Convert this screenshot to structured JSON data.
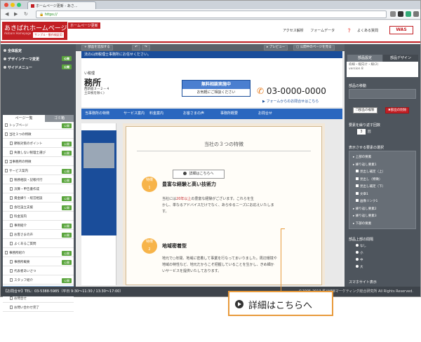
{
  "browser": {
    "tab_title": "ホームページ更新 - あさ...",
    "url": "https://",
    "colors": {
      "close": "#e74c3c",
      "min": "#f1c40f",
      "max": "#2ecc71"
    }
  },
  "header": {
    "logo_text": "あきばれホームページ",
    "logo_sub": "Akibare Homepage",
    "logo_tag": "サンプル・動作検証用",
    "page_tag": "ホームページ更新",
    "links": [
      "アクセス解析",
      "フォームデータ",
      "よくある質問"
    ],
    "brand": "WAS",
    "accent": "#c21f24"
  },
  "left_panel": {
    "items": [
      {
        "label": "全体設定"
      },
      {
        "label": "デザインテーマ変更",
        "badge": "公開"
      },
      {
        "label": "サイドメニュー",
        "badge": "公開"
      }
    ],
    "tabs": {
      "page_list": "ページ一覧",
      "trash": "ゴミ箱"
    },
    "publish": "公開",
    "pages": [
      "トップページ",
      "当社３つの特徴",
      "節税対策のポイント",
      "失敗しない税理士選び",
      "当事務所の特徴",
      "サービス案内",
      "税務相談・記帳代行",
      "決算・申告書作成",
      "資金繰り・経営相談",
      "会社設立支援",
      "料金案内",
      "事例紹介",
      "お客さまの声",
      "よくあるご質問",
      "事務所紹介",
      "事務所概要",
      "代表者あいさつ",
      "スタッフ紹介",
      "お客様の声",
      "お問合せ",
      "お問い合わせ完了"
    ],
    "selected_index": 18,
    "add_page": "ページ追加"
  },
  "toolbar": {
    "add_section": "部品を追加する",
    "undo": "↶",
    "redo": "↷",
    "preview": "プレビュー",
    "publish_page": "公開中のページを見る"
  },
  "site": {
    "top_bar": "法の山田税理士事務所にお任せください。",
    "subtitle": "い税理",
    "title": "務所",
    "address": [
      "西新宿３－２－４",
      "土日祝を除く)"
    ],
    "free_consult": "無料相談実施中",
    "consult_sub": "お気軽にご相談ください",
    "phone": "03-0000-0000",
    "phone_icon": "phone-icon",
    "form_link": "フォームからのお問合せはこちら",
    "nav": [
      "当事務所の特徴",
      "サービス案内",
      "料金案内",
      "お客さまの声",
      "事務所概要",
      "お問合せ"
    ],
    "card_title": "当社の３つの特徴",
    "features": [
      {
        "badge": "特徴\n1",
        "title": "豊富な経験と高い技術力",
        "body_pre": "当社には",
        "body_red": "20年以上",
        "body_post": "の豊富な経験がございます。これらを生",
        "body2": "かし、単なるアドバイスだけでなく、あらゆるニーズにお応えいたしま",
        "body3": "す。"
      },
      {
        "badge": "特徴\n2",
        "title": "地域密着型",
        "body1": "地元で○年間、地域に密着して事業を行なってまいりました。周辺環境や",
        "body2": "地域の特性など、地元だからこそ把握していることを生かし、きめ細か",
        "body3": "いサービスを提供いたしております。"
      }
    ],
    "detail_button": "詳細はこちらへ"
  },
  "right_panel": {
    "tabs": {
      "settings": "部品設定",
      "design": "部品デザイン"
    },
    "info": [
      "枠線・縦向け・線(2)",
      "version 8"
    ],
    "move_label": "部品の移動",
    "copy_btn": "部品の複製",
    "delete_btn": "部品の削除",
    "repeat_label": "要素を繰り返す回数",
    "repeat_value": "3",
    "repeat_unit": "回",
    "show_label": "表示させる要素の選択",
    "elements": [
      "上部の要素",
      "繰り返し要素1",
      "見出し補足（上）",
      "見出し（特徴）",
      "見出し補足（下）",
      "文章1",
      "画像リンク1",
      "繰り返し要素2",
      "繰り返し要素3",
      "下部の要素"
    ],
    "margin_label": "部品上部の間隔",
    "margin_options": [
      "なし",
      "小",
      "中",
      "大"
    ],
    "sp_label": "スマホサイト表示"
  },
  "footer": {
    "left": "【お問合せ】TEL：03-5388-5985（平日 9:30～11:30 / 13:30～17:00）",
    "right": "©2005-2013 株)WEBマーケティング総合研究所 All Rights Reserved."
  },
  "callout": {
    "text": "詳細はこちらへ",
    "color": "#e89a3c"
  }
}
